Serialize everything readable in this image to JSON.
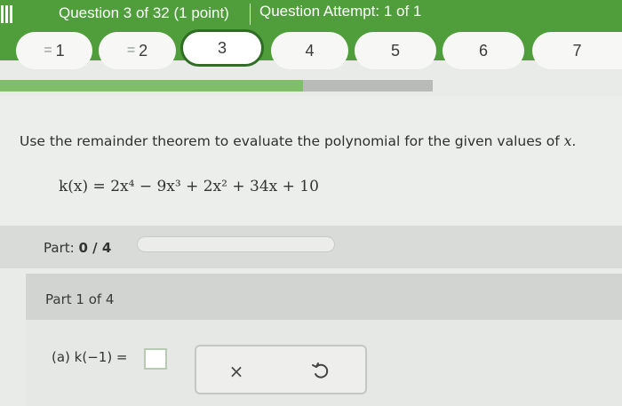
{
  "header": {
    "menu_icon": "hamburger-icon",
    "question_title": "Question 3 of 32 (1 point)",
    "attempt_label": "Question Attempt: 1 of 1"
  },
  "question_nav": [
    {
      "label": "1",
      "prefix": "="
    },
    {
      "label": "2",
      "prefix": "="
    },
    {
      "label": "3",
      "active": true
    },
    {
      "label": "4"
    },
    {
      "label": "5"
    },
    {
      "label": "6"
    },
    {
      "label": "7"
    }
  ],
  "progress": {
    "fraction": 0.7
  },
  "question": {
    "prompt": "Use the remainder theorem to evaluate the polynomial for the given values of",
    "prompt_var": "x",
    "prompt_end": ".",
    "function": "k(x) = 2x⁴ − 9x³ + 2x² + 34x + 10"
  },
  "part": {
    "label": "Part:",
    "score": "0 / 4",
    "part_of": "Part 1 of 4"
  },
  "answer": {
    "label": "(a) k(−1) ="
  },
  "actions": {
    "clear_icon": "x-icon",
    "undo_icon": "undo-icon",
    "clear_symbol": "×"
  }
}
